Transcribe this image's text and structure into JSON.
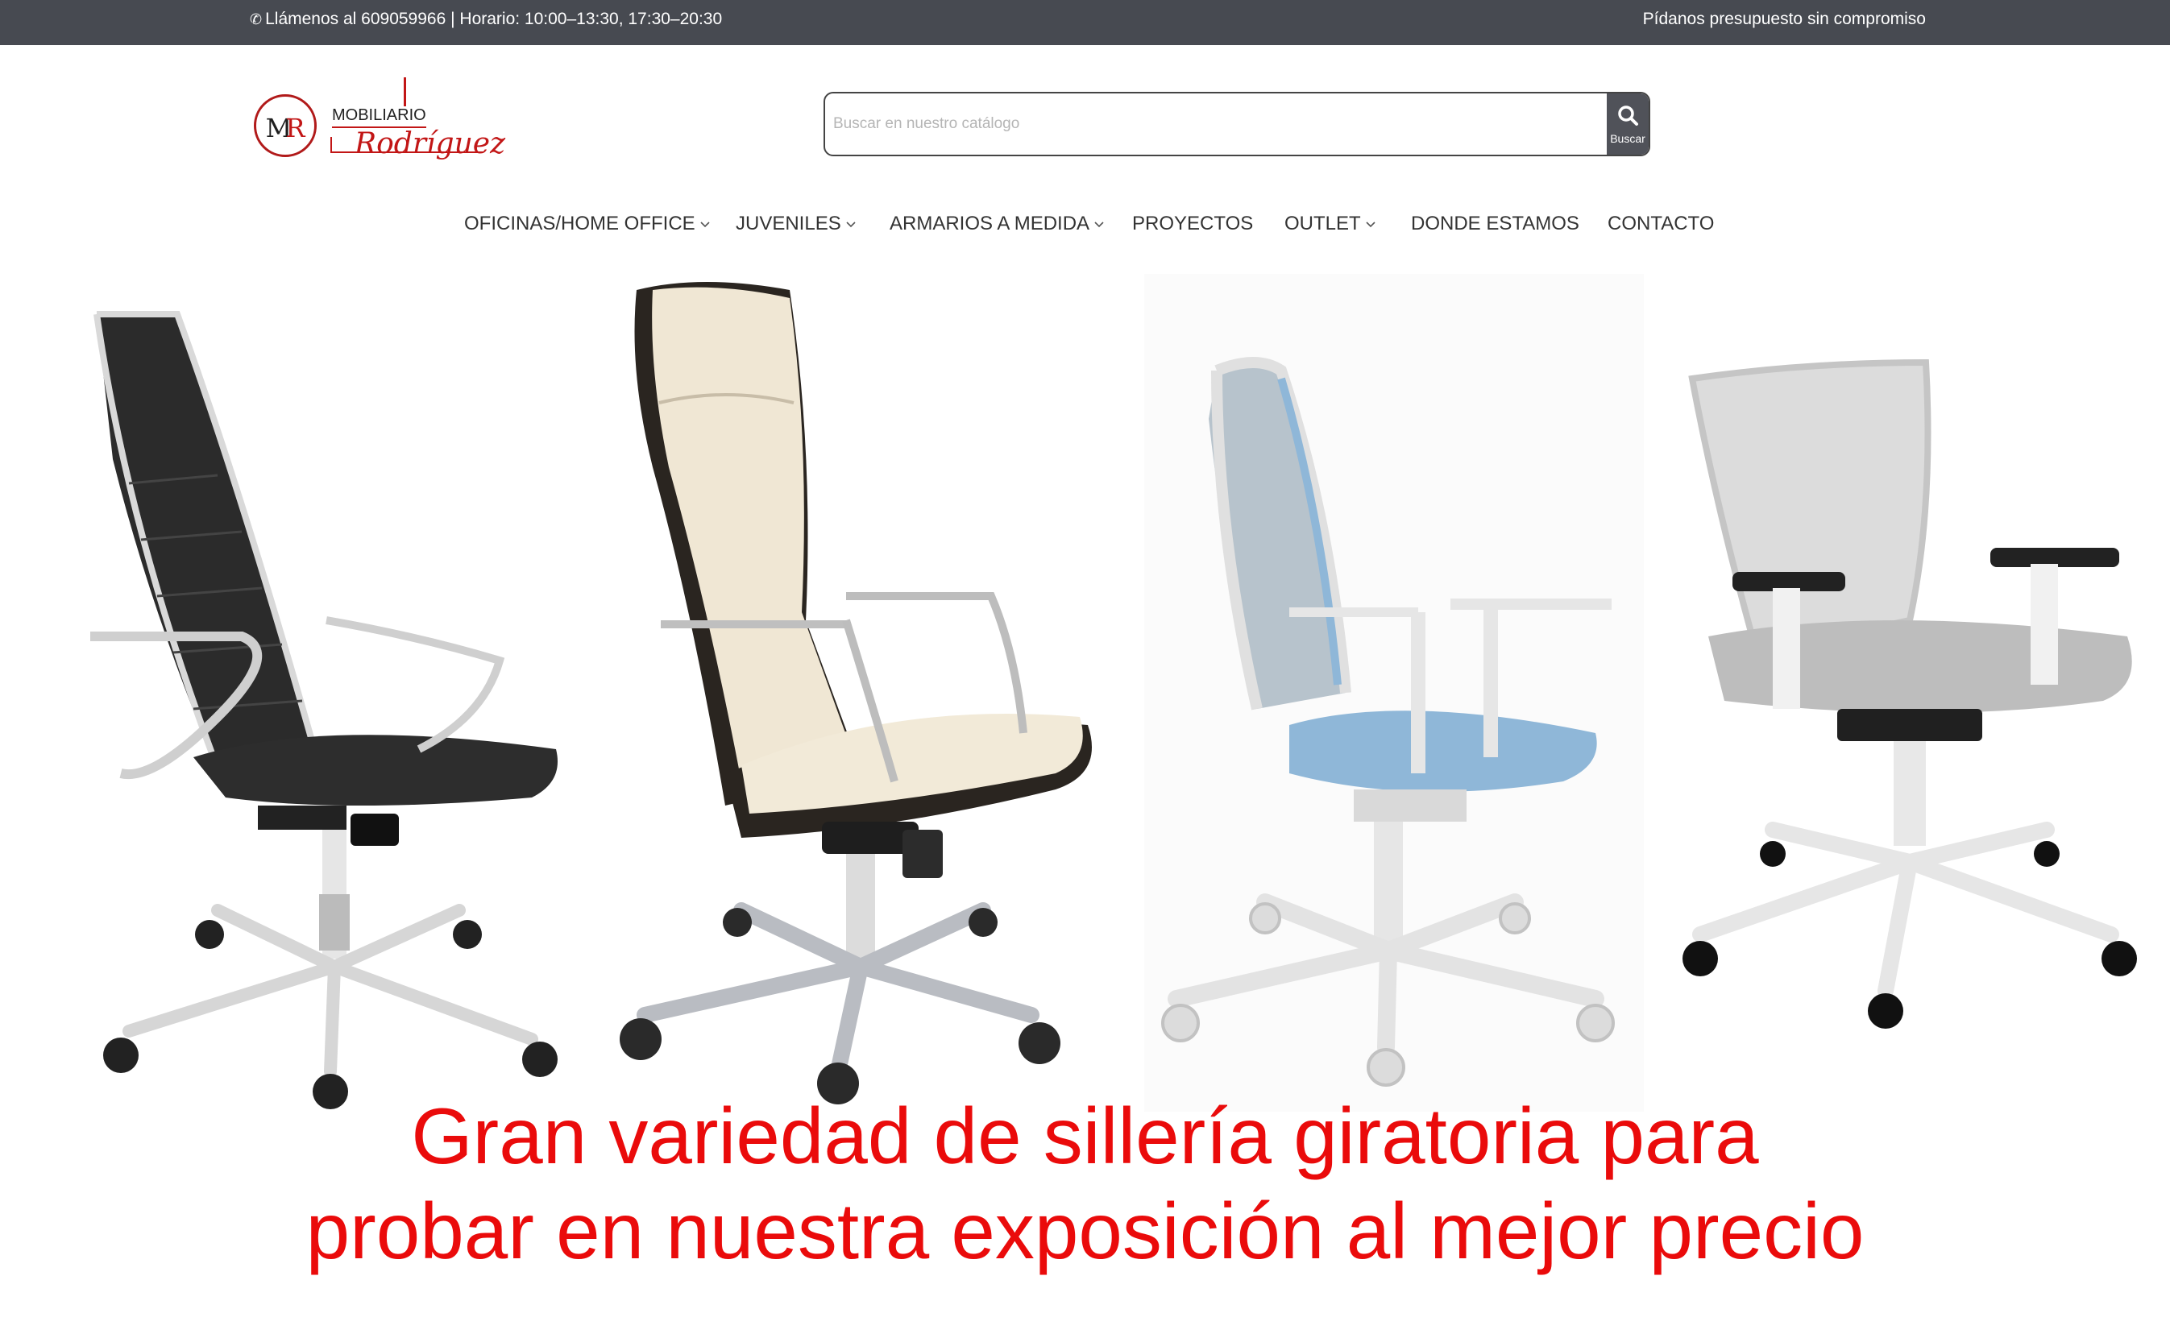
{
  "topbar": {
    "contact": "Llámenos al 609059966 | Horario: 10:00–13:30, 17:30–20:30",
    "quote": "Pídanos presupuesto sin compromiso"
  },
  "logo": {
    "monogram": "MR",
    "line1": "MOBILIARIO",
    "line2": "Rodríguez"
  },
  "search": {
    "placeholder": "Buscar en nuestro catálogo",
    "button_label": "Buscar"
  },
  "nav": {
    "items": [
      {
        "label": "OFICINAS/HOME OFFICE",
        "dropdown": true
      },
      {
        "label": "JUVENILES",
        "dropdown": true
      },
      {
        "label": "ARMARIOS A MEDIDA",
        "dropdown": true
      },
      {
        "label": "PROYECTOS",
        "dropdown": false
      },
      {
        "label": "OUTLET",
        "dropdown": true
      },
      {
        "label": "DONDE ESTAMOS",
        "dropdown": false
      },
      {
        "label": "CONTACTO",
        "dropdown": false
      }
    ]
  },
  "hero": {
    "caption_line1": "Gran variedad de sillería giratoria para",
    "caption_line2": "probar en nuestra exposición al mejor precio",
    "chairs": [
      {
        "name": "black-leather-executive-chair",
        "color": "#2b2b2b"
      },
      {
        "name": "cream-leather-executive-chair",
        "color": "#efe6d2"
      },
      {
        "name": "blue-mesh-task-chair",
        "color": "#8fb7d8"
      },
      {
        "name": "grey-mesh-task-chair",
        "color": "#bdbdbd"
      }
    ]
  },
  "colors": {
    "topbar_bg": "#474a51",
    "accent_red": "#ea0b0b",
    "logo_red": "#c21616"
  }
}
